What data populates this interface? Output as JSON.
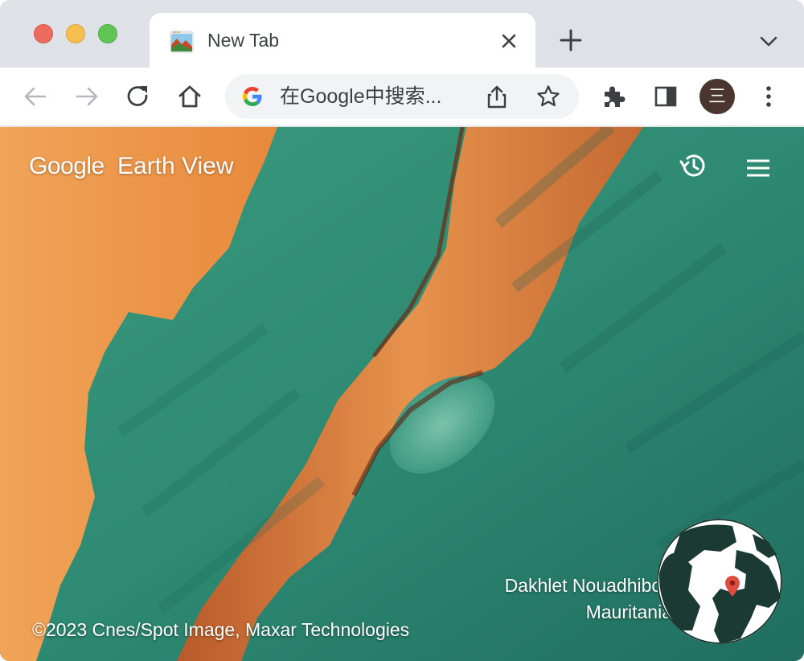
{
  "browser": {
    "tab": {
      "title": "New Tab",
      "favicon": "earth-view-favicon"
    },
    "omnibox": {
      "text": "在Google中搜索..."
    },
    "profile": {
      "initial": "三"
    }
  },
  "page": {
    "brand": {
      "google": "Google",
      "product": "Earth View"
    },
    "location": {
      "line1": "Dakhlet Nouadhibou",
      "line2": "Mauritania"
    },
    "copyright": "©2023 Cnes/Spot Image, Maxar Technologies"
  },
  "colors": {
    "tabstrip": "#dee1e6",
    "sand": "#e8893c",
    "sea": "#2f8a73",
    "avatar": "#4a3530",
    "pin": "#e04b3f"
  },
  "icons": {
    "toolbar": [
      "back-icon",
      "forward-icon",
      "reload-icon",
      "home-icon",
      "share-icon",
      "bookmark-star-icon",
      "extensions-icon",
      "side-panel-icon",
      "kebab-menu-icon"
    ],
    "page": [
      "history-icon",
      "hamburger-menu-icon",
      "globe-icon",
      "location-pin-icon"
    ]
  }
}
